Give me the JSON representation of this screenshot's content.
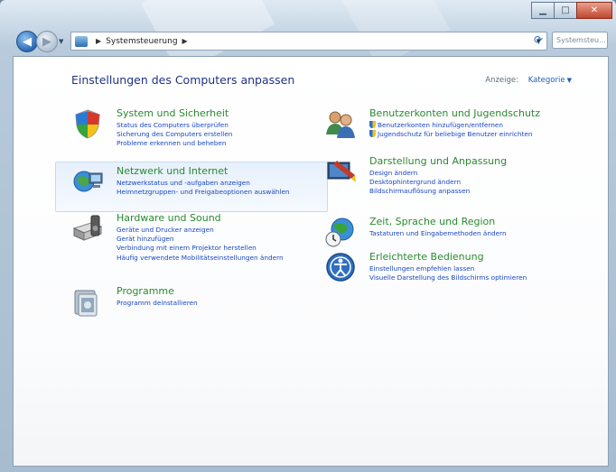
{
  "window": {
    "caption_buttons": [
      "minimize",
      "maximize",
      "close"
    ]
  },
  "navigation": {
    "breadcrumb": "Systemsteuerung",
    "search_placeholder": "Systemsteu..."
  },
  "content": {
    "heading": "Einstellungen des Computers anpassen",
    "view_label": "Anzeige:",
    "view_value": "Kategorie"
  },
  "categories": [
    {
      "title": "System und Sicherheit",
      "icon": "shield-icon",
      "links": [
        "Status des Computers überprüfen",
        "Sicherung des Computers erstellen",
        "Probleme erkennen und beheben"
      ]
    },
    {
      "title": "Netzwerk und Internet",
      "icon": "network-icon",
      "links": [
        "Netzwerkstatus und -aufgaben anzeigen",
        "Heimnetzgruppen- und Freigabeoptionen auswählen"
      ]
    },
    {
      "title": "Hardware und Sound",
      "icon": "printer-icon",
      "links": [
        "Geräte und Drucker anzeigen",
        "Gerät hinzufügen",
        "Verbindung mit einem Projektor herstellen",
        "Häufig verwendete Mobilitätseinstellungen ändern"
      ]
    },
    {
      "title": "Programme",
      "icon": "programs-icon",
      "links": [
        "Programm deinstallieren"
      ]
    },
    {
      "title": "Benutzerkonten und Jugendschutz",
      "icon": "users-icon",
      "links": [
        "Benutzerkonten hinzufügen/entfernen",
        "Jugendschutz für beliebige Benutzer einrichten"
      ]
    },
    {
      "title": "Darstellung und Anpassung",
      "icon": "appearance-icon",
      "links": [
        "Design ändern",
        "Desktophintergrund ändern",
        "Bildschirmauflösung anpassen"
      ]
    },
    {
      "title": "Zeit, Sprache und Region",
      "icon": "globe-clock-icon",
      "links": [
        "Tastaturen und Eingabemethoden ändern"
      ]
    },
    {
      "title": "Erleichterte Bedienung",
      "icon": "accessibility-icon",
      "links": [
        "Einstellungen empfehlen lassen",
        "Visuelle Darstellung des Bildschirms optimieren"
      ]
    }
  ]
}
